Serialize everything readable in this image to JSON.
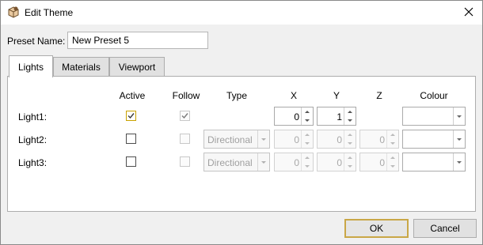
{
  "window": {
    "title": "Edit Theme"
  },
  "preset": {
    "label": "Preset Name:",
    "value": "New Preset 5"
  },
  "tabs": [
    {
      "label": "Lights",
      "active": true
    },
    {
      "label": "Materials",
      "active": false
    },
    {
      "label": "Viewport",
      "active": false
    }
  ],
  "columns": {
    "active": "Active",
    "follow": "Follow",
    "type": "Type",
    "x": "X",
    "y": "Y",
    "z": "Z",
    "colour": "Colour"
  },
  "lights": [
    {
      "label": "Light1:",
      "active": true,
      "follow": true,
      "type": "",
      "x": "0",
      "y": "1",
      "z": ""
    },
    {
      "label": "Light2:",
      "active": false,
      "follow": false,
      "type": "Directional",
      "x": "0",
      "y": "0",
      "z": "0"
    },
    {
      "label": "Light3:",
      "active": false,
      "follow": false,
      "type": "Directional",
      "x": "0",
      "y": "0",
      "z": "0"
    }
  ],
  "buttons": {
    "ok": "OK",
    "cancel": "Cancel"
  },
  "icons": {
    "app": "theme-app-icon",
    "close": "close-icon",
    "check": "check-icon",
    "dropdown": "dropdown-arrow-icon",
    "spin_up": "spin-up-icon",
    "spin_down": "spin-down-icon"
  },
  "colors": {
    "focus_accent": "#c9a747",
    "disabled_text": "#a0a0a0"
  }
}
